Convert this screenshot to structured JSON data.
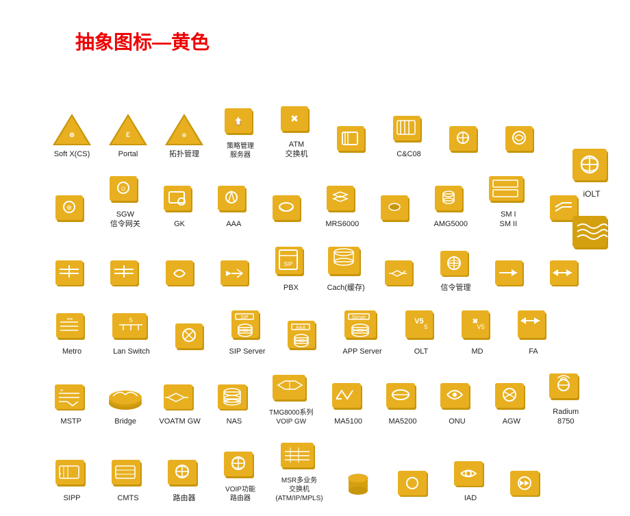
{
  "title": "抽象图标—黄色",
  "colors": {
    "gold_light": "#e8b020",
    "gold_mid": "#c8960c",
    "gold_dark": "#a07008",
    "white": "#ffffff",
    "text": "#222222",
    "title_red": "#cc0000"
  },
  "rows": [
    {
      "id": "row1",
      "items": [
        {
          "id": "softxcs",
          "label": "Soft X(CS)",
          "shape": "triangle"
        },
        {
          "id": "portal",
          "label": "Portal",
          "shape": "triangle"
        },
        {
          "id": "topology",
          "label": "拓扑管理",
          "shape": "triangle"
        },
        {
          "id": "policy_server",
          "label": "策略管理\n服务器",
          "shape": "cube"
        },
        {
          "id": "atm_switch",
          "label": "ATM\n交换机",
          "shape": "cube"
        },
        {
          "id": "unknown1",
          "label": "",
          "shape": "cube"
        },
        {
          "id": "candc08",
          "label": "C&C08",
          "shape": "cube"
        },
        {
          "id": "unknown2",
          "label": "",
          "shape": "cube"
        },
        {
          "id": "unknown3",
          "label": "",
          "shape": "cube"
        }
      ]
    },
    {
      "id": "row2",
      "items": [
        {
          "id": "unknown4",
          "label": "",
          "shape": "cube"
        },
        {
          "id": "sgw",
          "label": "SGW\n信令网关",
          "shape": "cube"
        },
        {
          "id": "gk",
          "label": "GK",
          "shape": "cube"
        },
        {
          "id": "aaa",
          "label": "AAA",
          "shape": "cube"
        },
        {
          "id": "unknown5",
          "label": "",
          "shape": "cube"
        },
        {
          "id": "mrs6000",
          "label": "MRS6000",
          "shape": "cube"
        },
        {
          "id": "unknown6",
          "label": "",
          "shape": "cube"
        },
        {
          "id": "amg5000",
          "label": "AMG5000",
          "shape": "cube"
        },
        {
          "id": "sm",
          "label": "SM I\nSM II",
          "shape": "cube-wide"
        },
        {
          "id": "unknown7",
          "label": "",
          "shape": "cube"
        }
      ]
    },
    {
      "id": "row3",
      "items": [
        {
          "id": "unknown8",
          "label": "",
          "shape": "cube"
        },
        {
          "id": "unknown9",
          "label": "",
          "shape": "cube"
        },
        {
          "id": "unknown10",
          "label": "",
          "shape": "cube"
        },
        {
          "id": "unknown11",
          "label": "",
          "shape": "cube"
        },
        {
          "id": "pbx",
          "label": "PBX",
          "shape": "cube"
        },
        {
          "id": "cache",
          "label": "Cach(缓存)",
          "shape": "cube"
        },
        {
          "id": "unknown12",
          "label": "",
          "shape": "cube"
        },
        {
          "id": "signal_mgmt",
          "label": "信令管理",
          "shape": "cube"
        },
        {
          "id": "unknown13",
          "label": "",
          "shape": "cube"
        },
        {
          "id": "unknown14",
          "label": "",
          "shape": "cube"
        }
      ]
    },
    {
      "id": "row4",
      "items": [
        {
          "id": "metro",
          "label": "Metro",
          "shape": "cube"
        },
        {
          "id": "lan_switch",
          "label": "Lan Switch",
          "shape": "cube"
        },
        {
          "id": "unknown15",
          "label": "",
          "shape": "cube"
        },
        {
          "id": "sip_server",
          "label": "SIP Server",
          "shape": "cube"
        },
        {
          "id": "unknown16",
          "label": "",
          "shape": "cube"
        },
        {
          "id": "app_server",
          "label": "APP Server",
          "shape": "cube"
        },
        {
          "id": "olt",
          "label": "OLT",
          "shape": "cube"
        },
        {
          "id": "md",
          "label": "MD",
          "shape": "cube"
        },
        {
          "id": "fa",
          "label": "FA",
          "shape": "cube"
        }
      ]
    },
    {
      "id": "row5",
      "items": [
        {
          "id": "mstp",
          "label": "MSTP",
          "shape": "cube"
        },
        {
          "id": "bridge",
          "label": "Bridge",
          "shape": "wavy"
        },
        {
          "id": "voatm_gw",
          "label": "VOATM GW",
          "shape": "cube"
        },
        {
          "id": "nas",
          "label": "NAS",
          "shape": "cube"
        },
        {
          "id": "tmg8000",
          "label": "TMG8000系列\nVOIP GW",
          "shape": "cube"
        },
        {
          "id": "ma5100",
          "label": "MA5100",
          "shape": "cube"
        },
        {
          "id": "ma5200",
          "label": "MA5200",
          "shape": "cube"
        },
        {
          "id": "onu",
          "label": "ONU",
          "shape": "cube"
        },
        {
          "id": "agw",
          "label": "AGW",
          "shape": "cube"
        },
        {
          "id": "radium8750",
          "label": "Radium\n8750",
          "shape": "cube"
        }
      ]
    },
    {
      "id": "row6",
      "items": [
        {
          "id": "sipp",
          "label": "SIPP",
          "shape": "cube"
        },
        {
          "id": "cmts",
          "label": "CMTS",
          "shape": "cube"
        },
        {
          "id": "router",
          "label": "路由器",
          "shape": "cube"
        },
        {
          "id": "voip_router",
          "label": "VOIP功能\n路由器",
          "shape": "cube"
        },
        {
          "id": "msr",
          "label": "MSR多业务\n交换机\n(ATM/IP/MPLS)",
          "shape": "cube"
        },
        {
          "id": "unknown17",
          "label": "",
          "shape": "cylinder"
        },
        {
          "id": "unknown18",
          "label": "",
          "shape": "cube"
        },
        {
          "id": "iad",
          "label": "IAD",
          "shape": "cube"
        },
        {
          "id": "unknown19",
          "label": "",
          "shape": "cube"
        }
      ]
    }
  ],
  "right_icons": [
    {
      "id": "iolt",
      "label": "iOLT"
    },
    {
      "id": "big_unknown",
      "label": ""
    }
  ]
}
